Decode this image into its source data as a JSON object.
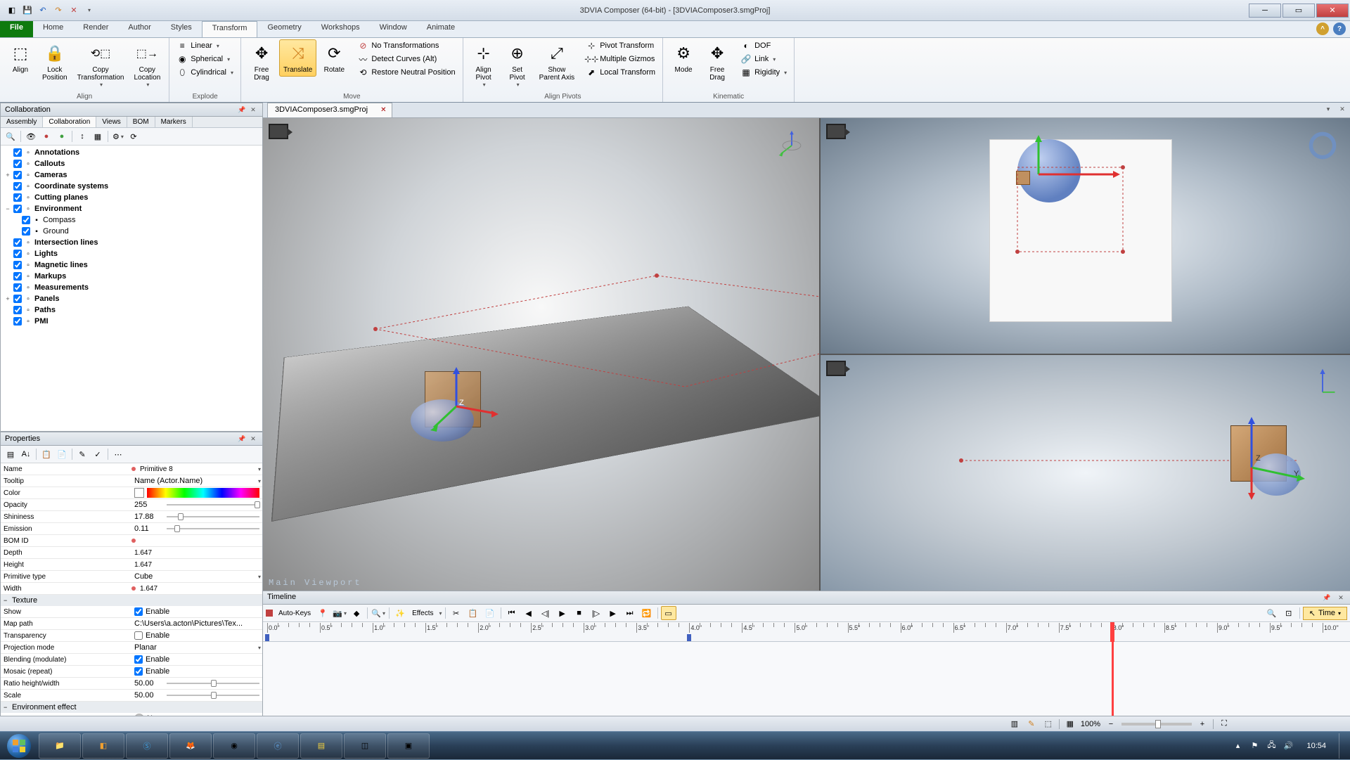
{
  "window": {
    "title": "3DVIA Composer (64-bit) - [3DVIAComposer3.smgProj]"
  },
  "ribbon": {
    "file": "File",
    "tabs": [
      "Home",
      "Render",
      "Author",
      "Styles",
      "Transform",
      "Geometry",
      "Workshops",
      "Window",
      "Animate"
    ],
    "active": "Transform",
    "groups": {
      "align": {
        "label": "Align",
        "align_btn": "Align",
        "lock_btn": "Lock\nPosition",
        "copy_tr": "Copy\nTransformation",
        "copy_loc": "Copy\nLocation"
      },
      "explode": {
        "label": "Explode",
        "linear": "Linear",
        "spherical": "Spherical",
        "cylindrical": "Cylindrical"
      },
      "move": {
        "label": "Move",
        "free_drag": "Free\nDrag",
        "translate": "Translate",
        "rotate": "Rotate",
        "no_trans": "No Transformations",
        "detect": "Detect Curves (Alt)",
        "restore": "Restore Neutral Position"
      },
      "align_pivots": {
        "label": "Align Pivots",
        "align_pivot": "Align\nPivot",
        "set_pivot": "Set\nPivot",
        "show_pa": "Show\nParent Axis",
        "pivot_tr": "Pivot Transform",
        "multi": "Multiple Gizmos",
        "local": "Local Transform"
      },
      "kinematic": {
        "label": "Kinematic",
        "mode": "Mode",
        "free_drag2": "Free\nDrag",
        "dof": "DOF",
        "link": "Link",
        "rigidity": "Rigidity"
      }
    }
  },
  "doc_tab": "3DVIAComposer3.smgProj",
  "collab": {
    "title": "Collaboration",
    "subtabs": [
      "Assembly",
      "Collaboration",
      "Views",
      "BOM",
      "Markers"
    ],
    "active": "Collaboration",
    "items": [
      {
        "l": "Annotations",
        "exp": "",
        "c": true
      },
      {
        "l": "Callouts",
        "exp": "",
        "c": true
      },
      {
        "l": "Cameras",
        "exp": "+",
        "c": true
      },
      {
        "l": "Coordinate systems",
        "exp": "",
        "c": true
      },
      {
        "l": "Cutting planes",
        "exp": "",
        "c": true
      },
      {
        "l": "Environment",
        "exp": "−",
        "c": true,
        "children": [
          {
            "l": "Compass",
            "c": true
          },
          {
            "l": "Ground",
            "c": true
          }
        ]
      },
      {
        "l": "Intersection lines",
        "exp": "",
        "c": true
      },
      {
        "l": "Lights",
        "exp": "",
        "c": true
      },
      {
        "l": "Magnetic lines",
        "exp": "",
        "c": true
      },
      {
        "l": "Markups",
        "exp": "",
        "c": true
      },
      {
        "l": "Measurements",
        "exp": "",
        "c": true
      },
      {
        "l": "Panels",
        "exp": "+",
        "c": true
      },
      {
        "l": "Paths",
        "exp": "",
        "c": true
      },
      {
        "l": "PMI",
        "exp": "",
        "c": true
      }
    ]
  },
  "props": {
    "title": "Properties",
    "name_l": "Name",
    "name_v": "Primitive 8",
    "tooltip_l": "Tooltip",
    "tooltip_v": "Name (Actor.Name)",
    "color_l": "Color",
    "opacity_l": "Opacity",
    "opacity_v": "255",
    "shininess_l": "Shininess",
    "shininess_v": "17.88",
    "emission_l": "Emission",
    "emission_v": "0.11",
    "bomid_l": "BOM ID",
    "bomid_v": "",
    "depth_l": "Depth",
    "depth_v": "1.647",
    "height_l": "Height",
    "height_v": "1.647",
    "primtype_l": "Primitive type",
    "primtype_v": "Cube",
    "width_l": "Width",
    "width_v": "1.647",
    "texture_section": "Texture",
    "show_l": "Show",
    "enable": "Enable",
    "mappath_l": "Map path",
    "mappath_v": "C:\\Users\\a.acton\\Pictures\\Tex...",
    "transparency_l": "Transparency",
    "projmode_l": "Projection mode",
    "projmode_v": "Planar",
    "blending_l": "Blending (modulate)",
    "mosaic_l": "Mosaic (repeat)",
    "ratio_l": "Ratio height/width",
    "ratio_v": "50.00",
    "scale_l": "Scale",
    "scale_v": "50.00",
    "env_section": "Environment effect",
    "type_l": "Type",
    "type_v": "None"
  },
  "viewport": {
    "main_label": "Main Viewport"
  },
  "timeline": {
    "title": "Timeline",
    "autokeys": "Auto-Keys",
    "effects": "Effects",
    "time": "Time",
    "playhead_at": 8.0,
    "ticks_major_step": 0.5,
    "range_end": 10.0,
    "keys": [
      0.0,
      4.0
    ]
  },
  "statusbar": {
    "zoom": "100%"
  },
  "taskbar": {
    "clock": "10:54"
  }
}
